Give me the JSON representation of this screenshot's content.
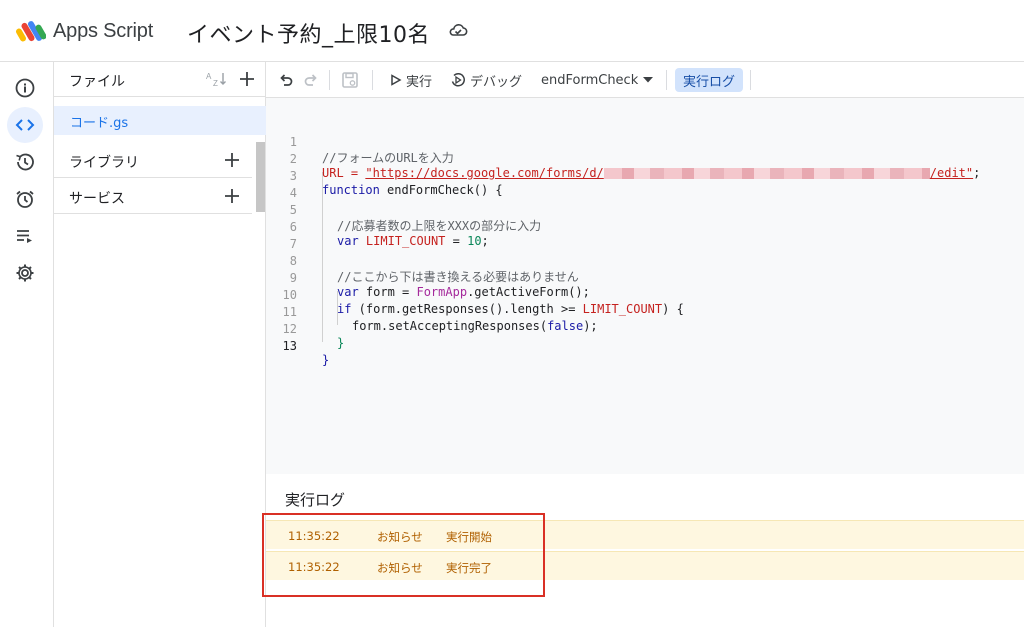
{
  "header": {
    "app_name": "Apps Script",
    "project_title": "イベント予約_上限10名",
    "logo_icon": "apps-script-logo",
    "cloud_icon": "cloud-saved-icon"
  },
  "rail": {
    "items": [
      {
        "icon": "info-icon"
      },
      {
        "icon": "code-icon",
        "active": true
      },
      {
        "icon": "history-icon"
      },
      {
        "icon": "alarm-trigger-icon"
      },
      {
        "icon": "executions-icon"
      },
      {
        "icon": "settings-gear-icon"
      }
    ]
  },
  "files": {
    "title": "ファイル",
    "selected_file": "コード.gs",
    "sections": [
      {
        "label": "ライブラリ"
      },
      {
        "label": "サービス"
      }
    ]
  },
  "toolbar": {
    "run_label": "実行",
    "debug_label": "デバッグ",
    "function_name": "endFormCheck",
    "log_label": "実行ログ"
  },
  "editor": {
    "line_numbers": [
      "1",
      "2",
      "3",
      "4",
      "5",
      "6",
      "7",
      "8",
      "9",
      "10",
      "11",
      "12",
      "13"
    ],
    "code": {
      "l1": "//フォームのURLを入力",
      "l2_prefix": "URL = ",
      "l2_url_start": "\"https://docs.google.com/forms/d/",
      "l2_url_end": "/edit\"",
      "l2_suffix": ";",
      "l3_kw": "function",
      "l3_rest": " endFormCheck() {",
      "l5": "//応募者数の上限をXXXの部分に入力",
      "l6_kw": "var",
      "l6_var": "LIMIT_COUNT",
      "l6_eq": " = ",
      "l6_num": "10",
      "l6_end": ";",
      "l8": "//ここから下は書き換える必要はありません",
      "l9_kw": "var",
      "l9_mid": " form = ",
      "l9_obj": "FormApp",
      "l9_end": ".getActiveForm();",
      "l10_kw": "if",
      "l10_mid": " (form.getResponses().length >= ",
      "l10_var": "LIMIT_COUNT",
      "l10_end": ") {",
      "l11_a": "form.setAcceptingResponses(",
      "l11_kw": "false",
      "l11_b": ");",
      "l12": "}",
      "l13": "}"
    }
  },
  "log": {
    "title": "実行ログ",
    "rows": [
      {
        "time": "11:35:22",
        "level": "お知らせ",
        "message": "実行開始"
      },
      {
        "time": "11:35:22",
        "level": "お知らせ",
        "message": "実行完了"
      }
    ]
  }
}
